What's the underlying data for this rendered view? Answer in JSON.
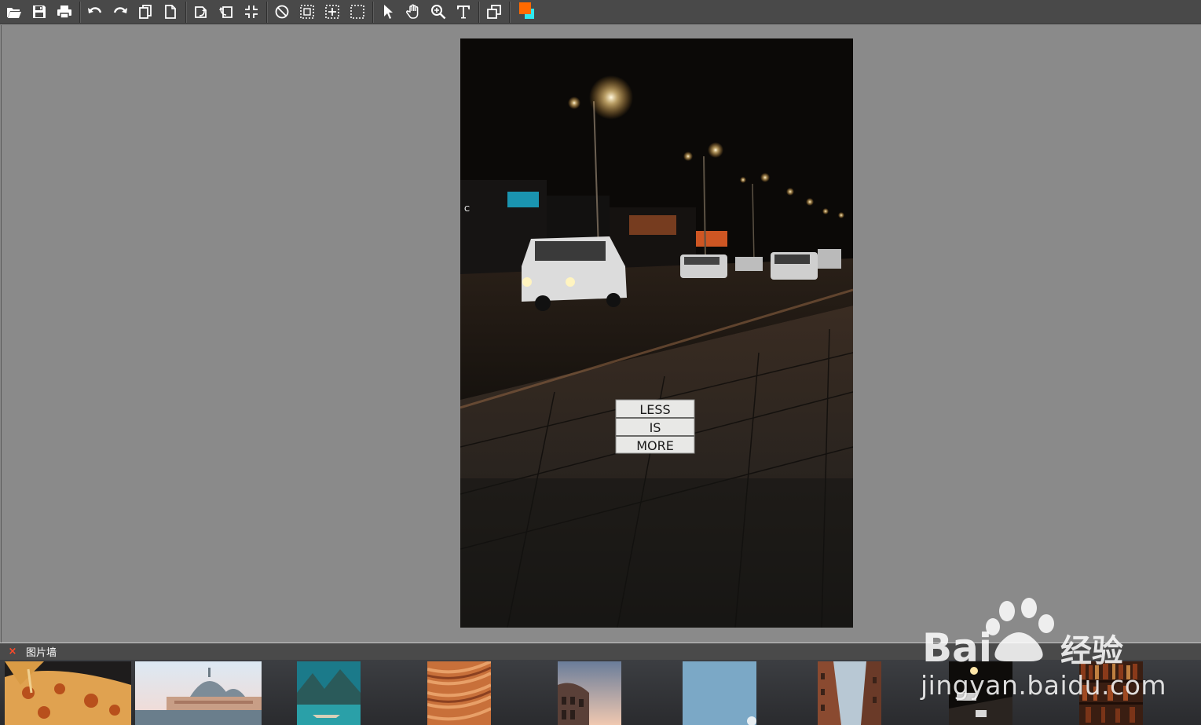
{
  "toolbar": {
    "groups": [
      [
        "open-icon",
        "save-icon",
        "print-icon"
      ],
      [
        "undo-icon",
        "redo-icon",
        "copy-icon",
        "new-page-icon"
      ],
      [
        "rotate-left-icon",
        "rotate-right-icon",
        "fit-icon"
      ],
      [
        "no-select-icon",
        "select-rect-icon",
        "select-grow-icon",
        "select-outline-icon"
      ],
      [
        "pointer-icon",
        "hand-icon",
        "zoom-icon",
        "text-icon"
      ],
      [
        "layers-icon"
      ]
    ],
    "colors": {
      "foreground": "#ff6a00",
      "background": "#2ee8ee"
    }
  },
  "canvas": {
    "photo_sign": [
      "LESS",
      "IS",
      "MORE"
    ]
  },
  "gallery": {
    "close_label": "×",
    "title": "图片墙",
    "thumbnails": [
      {
        "name": "pizza"
      },
      {
        "name": "cathedral-venice"
      },
      {
        "name": "lake-kayak"
      },
      {
        "name": "canyon-rock"
      },
      {
        "name": "colosseum"
      },
      {
        "name": "sky"
      },
      {
        "name": "city-street"
      },
      {
        "name": "night-street"
      },
      {
        "name": "bookshelf"
      }
    ]
  },
  "watermark": {
    "brand": "Bai",
    "brand_cn": "经验",
    "url": "jingyan.baidu.com"
  }
}
